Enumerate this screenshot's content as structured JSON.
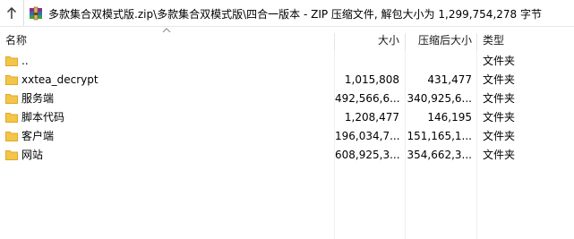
{
  "toolbar": {
    "up_icon": "up-arrow-icon",
    "archive_icon": "winrar-archive-icon",
    "path": "多款集合双模式版.zip\\多款集合双模式版\\四合一版本 - ZIP 压缩文件, 解包大小为 1,299,754,278 字节"
  },
  "columns": {
    "name": "名称",
    "size": "大小",
    "packed": "压缩后大小",
    "type": "类型"
  },
  "rows": [
    {
      "name": "..",
      "size": "",
      "packed": "",
      "type": "文件夹"
    },
    {
      "name": "xxtea_decrypt",
      "size": "1,015,808",
      "packed": "431,477",
      "type": "文件夹"
    },
    {
      "name": "服务端",
      "size": "492,566,6...",
      "packed": "340,925,6...",
      "type": "文件夹"
    },
    {
      "name": "脚本代码",
      "size": "1,208,477",
      "packed": "146,195",
      "type": "文件夹"
    },
    {
      "name": "客户端",
      "size": "196,034,7...",
      "packed": "151,165,1...",
      "type": "文件夹"
    },
    {
      "name": "网站",
      "size": "608,925,3...",
      "packed": "354,662,3...",
      "type": "文件夹"
    }
  ],
  "colors": {
    "folder": "#f3c548",
    "folder_dark": "#e0a82a"
  }
}
